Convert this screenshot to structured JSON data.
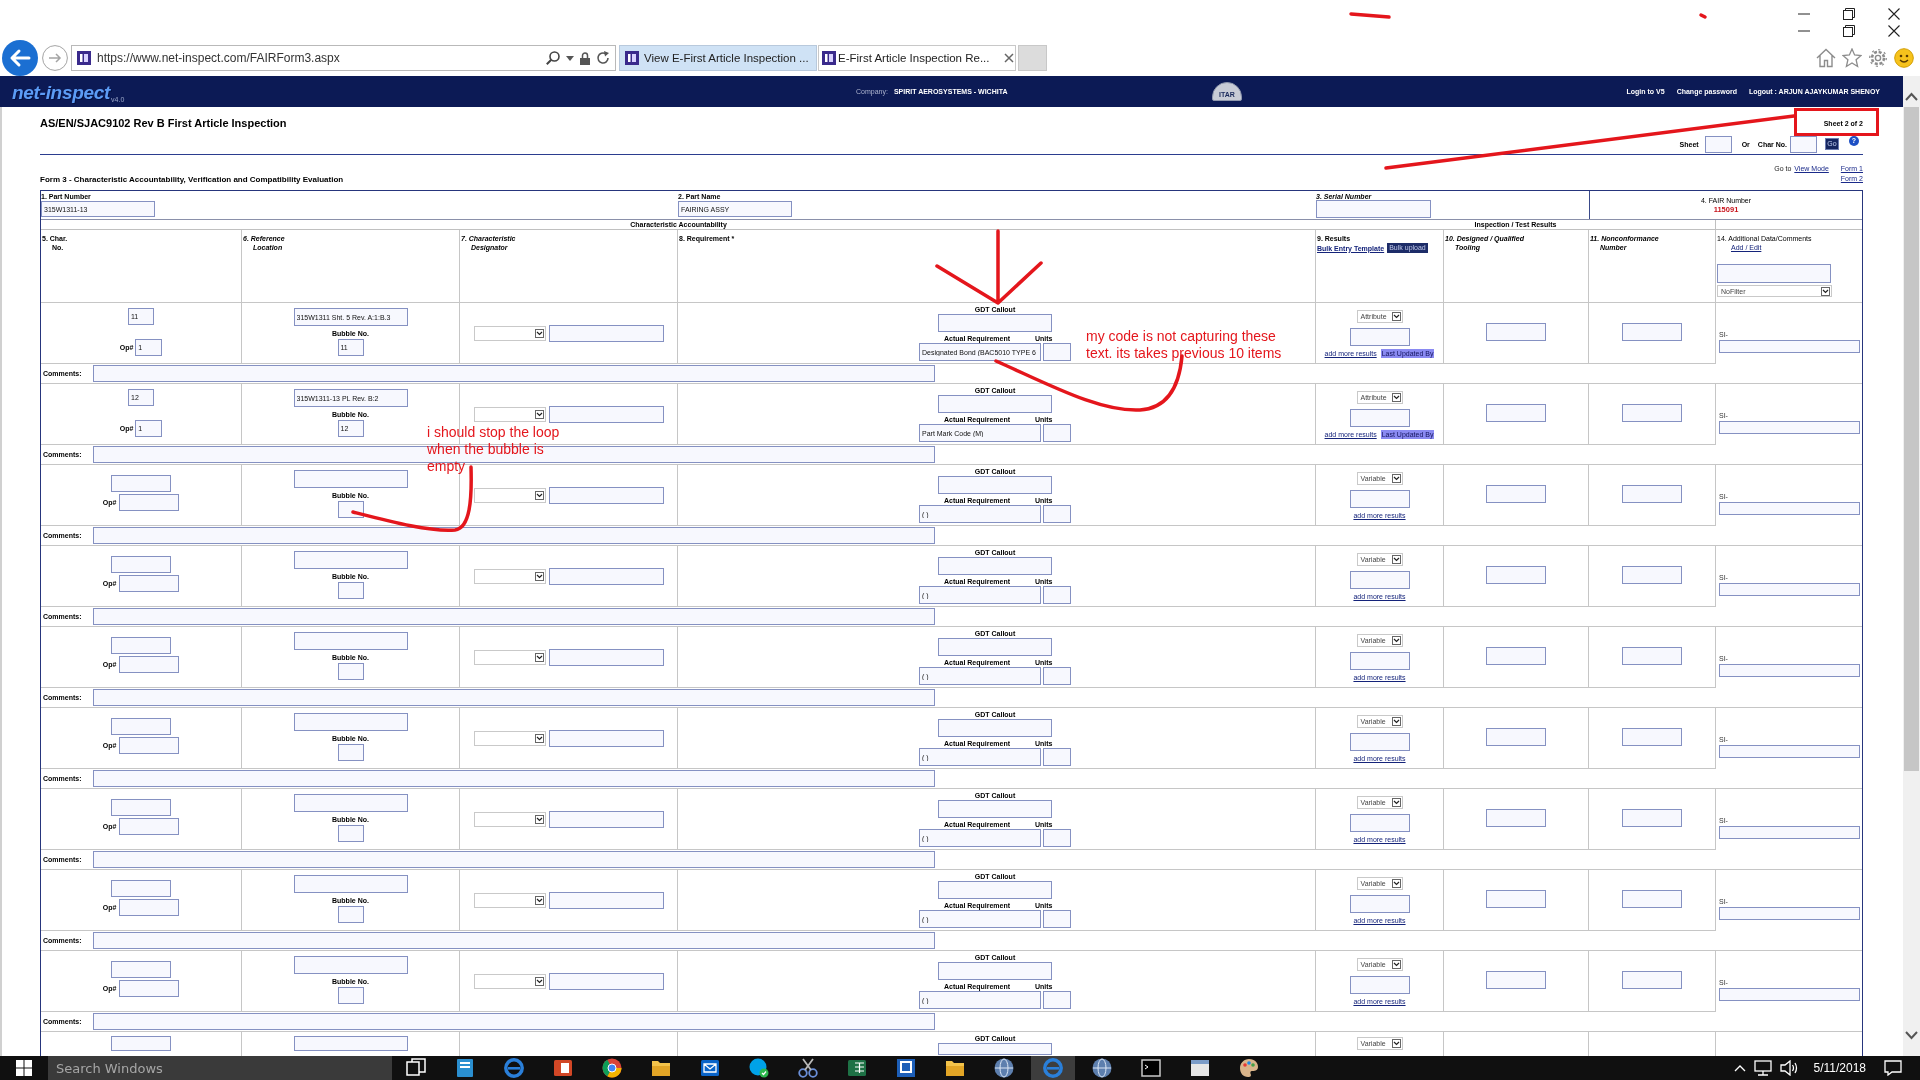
{
  "browser": {
    "address": "https://www.net-inspect.com/FAIRForm3.aspx",
    "tabs": [
      {
        "title": "View E-First Article Inspection ...",
        "selected": false
      },
      {
        "title": "E-First Article Inspection Re...",
        "selected": true
      }
    ]
  },
  "site_header": {
    "logo": "net-inspect",
    "version": "v4.0",
    "company_label": "Company:",
    "company": "SPIRIT AEROSYSTEMS - WICHITA",
    "badge": "ITAR",
    "links": [
      "Login to V5",
      "Change password",
      "Logout : ARJUN AJAYKUMAR SHENOY"
    ]
  },
  "page": {
    "title": "AS/EN/SJAC9102 Rev B First Article Inspection",
    "sheet_status": "Sheet 2 of 2",
    "sheet_label": "Sheet",
    "or_label": "Or",
    "char_label": "Char No.",
    "go_button": "Go",
    "help_button": "?",
    "goto_label": "Go to",
    "goto_link": "View Mode",
    "form_links": [
      "Form 1",
      "Form 2"
    ],
    "form_title": "Form 3 - Characteristic Accountability, Verification and Compatibility Evaluation"
  },
  "table": {
    "part_number_label": "1. Part Number",
    "part_number": "315W1311-13",
    "part_name_label": "2. Part Name",
    "part_name": "FAIRING ASSY",
    "serial_label": "3. Serial Number",
    "fair_label": "4. FAIR Number",
    "fair_number": "115091",
    "sections": [
      "Characteristic Accountability",
      "Inspection / Test Results"
    ],
    "columns": [
      {
        "lines": [
          "5. Char.",
          "No."
        ]
      },
      {
        "lines": [
          "6. Reference",
          "Location"
        ]
      },
      {
        "lines": [
          "7. Characteristic",
          "Designator"
        ]
      },
      {
        "lines": [
          "8. Requirement *"
        ]
      },
      {
        "lines": [
          "9. Results"
        ],
        "link": "Bulk Entry Template",
        "button": "Bulk upload"
      },
      {
        "lines": [
          "10. Designed / Qualified",
          "Tooling"
        ]
      },
      {
        "lines": [
          "11. Nonconformance",
          "Number"
        ]
      },
      {
        "lines": [
          "14. Additional Data/Comments"
        ],
        "link": "Add / Edit",
        "filter": "NoFilter"
      }
    ],
    "rows": [
      {
        "kind": "full",
        "char_no": "11",
        "op_label": "Op#",
        "op": "1",
        "reference": "315W1311 Sht. 5 Rev. A:1:B.3",
        "bubble_label": "Bubble No.",
        "bubble": "11",
        "gdt_label": "GDT Callout",
        "actual_label": "Actual Requirement",
        "units_label": "Units",
        "actual": "Designated Bond (BAC5010 TYPE 6",
        "result_type": "Attribute",
        "more_link": "add more results",
        "updated_badge": "Last Updated By",
        "si_label": "SI-",
        "comments_label": "Comments:"
      },
      {
        "kind": "full",
        "char_no": "12",
        "op_label": "Op#",
        "op": "1",
        "reference": "315W1311-13 PL Rev. B:2",
        "bubble_label": "Bubble No.",
        "bubble": "12",
        "gdt_label": "GDT Callout",
        "actual_label": "Actual Requirement",
        "units_label": "Units",
        "actual": "Part Mark Code (M)",
        "result_type": "Attribute",
        "more_link": "add more results",
        "updated_badge": "Last Updated By",
        "si_label": "SI-",
        "comments_label": "Comments:"
      },
      {
        "kind": "full",
        "op_label": "Op#",
        "bubble_label": "Bubble No.",
        "gdt_label": "GDT Callout",
        "actual_label": "Actual Requirement",
        "units_label": "Units",
        "actual": "( )",
        "result_type": "Variable",
        "more_link": "add more results",
        "si_label": "SI-",
        "comments_label": "Comments:"
      },
      {
        "kind": "full",
        "op_label": "Op#",
        "bubble_label": "Bubble No.",
        "gdt_label": "GDT Callout",
        "actual_label": "Actual Requirement",
        "units_label": "Units",
        "actual": "( )",
        "result_type": "Variable",
        "more_link": "add more results",
        "si_label": "SI-",
        "comments_label": "Comments:"
      },
      {
        "kind": "full",
        "op_label": "Op#",
        "bubble_label": "Bubble No.",
        "gdt_label": "GDT Callout",
        "actual_label": "Actual Requirement",
        "units_label": "Units",
        "actual": "( )",
        "result_type": "Variable",
        "more_link": "add more results",
        "si_label": "SI-",
        "comments_label": "Comments:"
      },
      {
        "kind": "full",
        "op_label": "Op#",
        "bubble_label": "Bubble No.",
        "gdt_label": "GDT Callout",
        "actual_label": "Actual Requirement",
        "units_label": "Units",
        "actual": "( )",
        "result_type": "Variable",
        "more_link": "add more results",
        "si_label": "SI-",
        "comments_label": "Comments:"
      },
      {
        "kind": "full",
        "op_label": "Op#",
        "bubble_label": "Bubble No.",
        "gdt_label": "GDT Callout",
        "actual_label": "Actual Requirement",
        "units_label": "Units",
        "actual": "( )",
        "result_type": "Variable",
        "more_link": "add more results",
        "si_label": "SI-",
        "comments_label": "Comments:"
      },
      {
        "kind": "full",
        "op_label": "Op#",
        "bubble_label": "Bubble No.",
        "gdt_label": "GDT Callout",
        "actual_label": "Actual Requirement",
        "units_label": "Units",
        "actual": "( )",
        "result_type": "Variable",
        "more_link": "add more results",
        "si_label": "SI-",
        "comments_label": "Comments:"
      },
      {
        "kind": "full",
        "op_label": "Op#",
        "bubble_label": "Bubble No.",
        "gdt_label": "GDT Callout",
        "actual_label": "Actual Requirement",
        "units_label": "Units",
        "actual": "( )",
        "result_type": "Variable",
        "more_link": "add more results",
        "si_label": "SI-",
        "comments_label": "Comments:"
      },
      {
        "kind": "partial",
        "gdt_label": "GDT Callout",
        "result_type": "Variable"
      }
    ]
  },
  "annotations": [
    {
      "text": "my code is not capturing these text. its takes previous 10 items"
    },
    {
      "text": "i should stop the loop when the bubble is empty"
    }
  ],
  "taskbar": {
    "placeholder": "Search Windows",
    "apps": [
      {
        "selected": false
      },
      {
        "selected": false
      },
      {
        "selected": false
      },
      {
        "selected": false
      },
      {
        "selected": false
      },
      {
        "selected": false
      },
      {
        "selected": false
      },
      {
        "selected": false
      },
      {
        "selected": false
      },
      {
        "selected": false
      },
      {
        "selected": false
      },
      {
        "selected": false
      },
      {
        "selected": false
      },
      {
        "selected": true
      },
      {
        "selected": false
      },
      {
        "selected": false
      },
      {
        "selected": false
      },
      {
        "selected": false
      }
    ],
    "date": "5/11/2018"
  }
}
